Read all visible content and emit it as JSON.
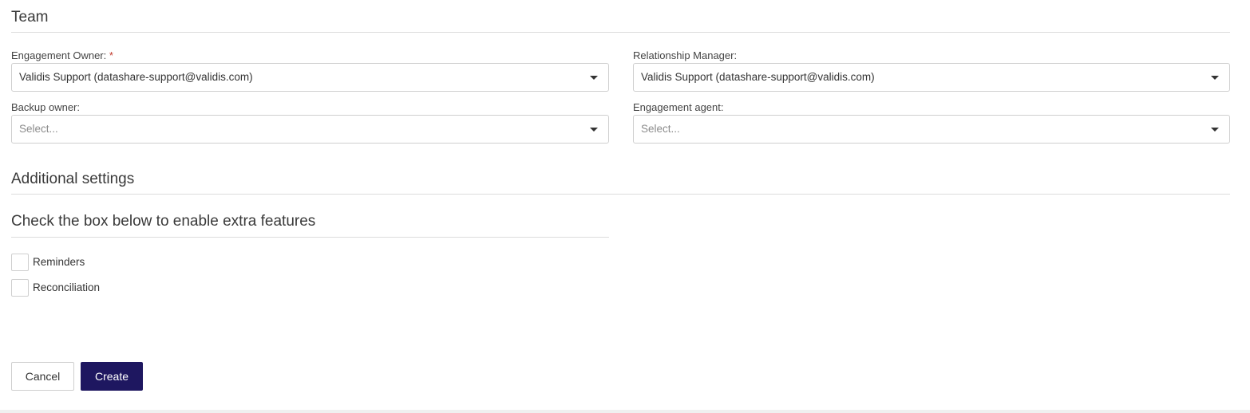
{
  "team": {
    "title": "Team",
    "engagement_owner": {
      "label": "Engagement Owner:",
      "required_mark": "*",
      "value": "Validis Support (datashare-support@validis.com)"
    },
    "relationship_manager": {
      "label": "Relationship Manager:",
      "value": "Validis Support (datashare-support@validis.com)"
    },
    "backup_owner": {
      "label": "Backup owner:",
      "placeholder": "Select..."
    },
    "engagement_agent": {
      "label": "Engagement agent:",
      "placeholder": "Select..."
    }
  },
  "additional": {
    "title": "Additional settings",
    "subtitle": "Check the box below to enable extra features",
    "options": [
      {
        "label": "Reminders",
        "checked": false
      },
      {
        "label": "Reconciliation",
        "checked": false
      }
    ]
  },
  "actions": {
    "cancel_label": "Cancel",
    "create_label": "Create"
  },
  "colors": {
    "primary": "#1e1760",
    "required": "#c0392b"
  },
  "icons": {
    "dropdown": "caret-down-icon"
  }
}
